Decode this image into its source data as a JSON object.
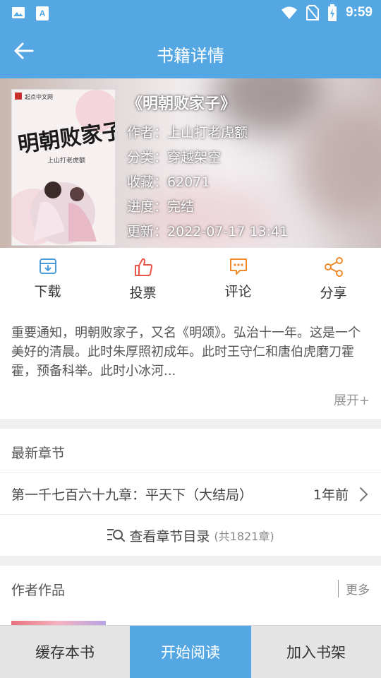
{
  "status_bar": {
    "time": "9:59"
  },
  "app_bar": {
    "title": "书籍详情"
  },
  "book": {
    "title": "《明朝败家子》",
    "author": "作者：上山打老虎额",
    "category": "分类：穿越架空",
    "favorites": "收藏：62071",
    "progress": "进度：完结",
    "updated": "更新：2022-07-17 13:41",
    "cover_publisher": "起点中文网",
    "cover_title": "明朝败家子",
    "cover_author": "上山打老虎额"
  },
  "actions": [
    {
      "label": "下载",
      "icon": "download-icon",
      "color": "#4a9bd9"
    },
    {
      "label": "投票",
      "icon": "thumbs-up-icon",
      "color": "#e95548"
    },
    {
      "label": "评论",
      "icon": "comment-icon",
      "color": "#f08a2c"
    },
    {
      "label": "分享",
      "icon": "share-icon",
      "color": "#f08a2c"
    }
  ],
  "intro": {
    "text": "重要通知，明朝败家子，又名《明颂》。弘治十一年。这是一个美好的清晨。此时朱厚照初成年。此时王守仁和唐伯虎磨刀霍霍，预备科举。此时小冰河...",
    "expand": "展开+"
  },
  "chapters": {
    "section_title": "最新章节",
    "latest_title": "第一千七百六十九章：平天下（大结局）",
    "latest_time": "1年前",
    "toc_label": "查看章节目录",
    "toc_count": "(共1821章)"
  },
  "works": {
    "section_title": "作者作品",
    "more": "更多"
  },
  "bottom_bar": {
    "cache": "缓存本书",
    "read": "开始阅读",
    "shelf": "加入书架"
  },
  "colors": {
    "accent": "#54a7e3"
  }
}
